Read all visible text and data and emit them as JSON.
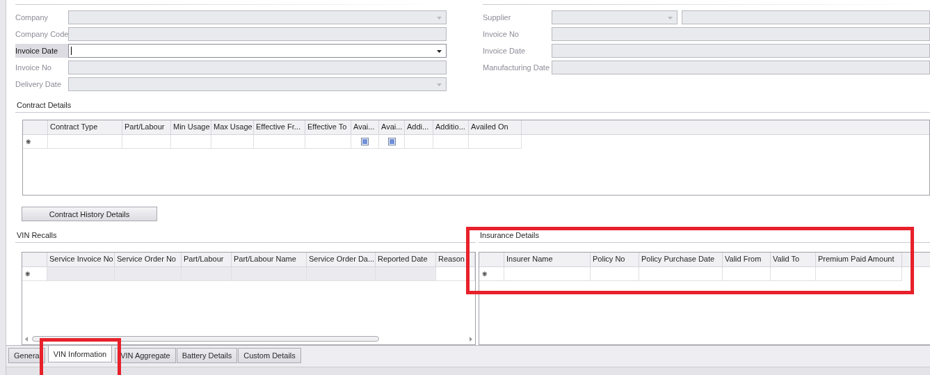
{
  "sale_information": {
    "fields": [
      {
        "label": "Company",
        "kind": "dropdown",
        "disabled": true
      },
      {
        "label": "Company Code",
        "kind": "text",
        "disabled": true
      },
      {
        "label": "Invoice Date",
        "kind": "dropdown",
        "disabled": false
      },
      {
        "label": "Invoice No",
        "kind": "text",
        "disabled": true
      },
      {
        "label": "Delivery Date",
        "kind": "dropdown",
        "disabled": true
      }
    ]
  },
  "purchase_information": {
    "fields": [
      {
        "label": "Supplier",
        "kind": "dropdown_text",
        "disabled": true
      },
      {
        "label": "Invoice No",
        "kind": "text",
        "disabled": true
      },
      {
        "label": "Invoice Date",
        "kind": "text",
        "disabled": true
      },
      {
        "label": "Manufacturing Date",
        "kind": "text",
        "disabled": true
      }
    ]
  },
  "contract_details": {
    "title": "Contract Details",
    "new_row_marker": "❋",
    "columns": [
      {
        "label": "Contract Type",
        "kind": "text"
      },
      {
        "label": "Part/Labour",
        "kind": "text"
      },
      {
        "label": "Min Usage",
        "kind": "text"
      },
      {
        "label": "Max Usage",
        "kind": "text"
      },
      {
        "label": "Effective Fr...",
        "kind": "text"
      },
      {
        "label": "Effective To",
        "kind": "text"
      },
      {
        "label": "Avai...",
        "kind": "checkbox",
        "indeterminate": true
      },
      {
        "label": "Avai...",
        "kind": "checkbox",
        "indeterminate": true
      },
      {
        "label": "Addi...",
        "kind": "text"
      },
      {
        "label": "Additio...",
        "kind": "text"
      },
      {
        "label": "Availed On",
        "kind": "text"
      }
    ]
  },
  "contract_history_button": "Contract History Details",
  "vin_recalls": {
    "title": "VIN Recalls",
    "new_row_marker": "❋",
    "columns": [
      {
        "label": "Service Invoice No",
        "kind": "readonly"
      },
      {
        "label": "Service Order No",
        "kind": "readonly"
      },
      {
        "label": "Part/Labour",
        "kind": "readonly"
      },
      {
        "label": "Part/Labour Name",
        "kind": "readonly"
      },
      {
        "label": "Service Order Da...",
        "kind": "readonly"
      },
      {
        "label": "Reported Date",
        "kind": "readonly"
      },
      {
        "label": "Reason",
        "kind": "text"
      }
    ]
  },
  "insurance_details": {
    "title": "Insurance Details",
    "new_row_marker": "❋",
    "columns": [
      {
        "label": "Insurer Name",
        "kind": "text"
      },
      {
        "label": "Policy No",
        "kind": "text"
      },
      {
        "label": "Policy Purchase Date",
        "kind": "text"
      },
      {
        "label": "Valid From",
        "kind": "text"
      },
      {
        "label": "Valid To",
        "kind": "text"
      },
      {
        "label": "Premium Paid Amount",
        "kind": "text"
      }
    ]
  },
  "tabs": [
    {
      "label": "Genera",
      "selected": false
    },
    {
      "label": "VIN Information",
      "selected": true
    },
    {
      "label": "VIN Aggregate",
      "selected": false
    },
    {
      "label": "Battery Details",
      "selected": false
    },
    {
      "label": "Custom Details",
      "selected": false
    }
  ]
}
